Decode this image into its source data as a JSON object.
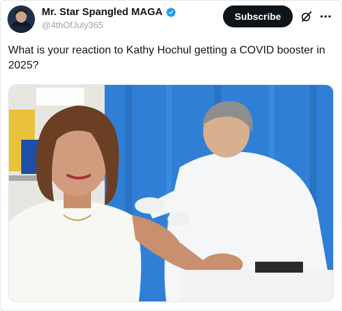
{
  "post": {
    "author": {
      "display_name": "Mr. Star Spangled MAGA",
      "handle": "@4thOfJuly365",
      "verified": true,
      "verified_color": "#1d9bf0"
    },
    "subscribe_label": "Subscribe",
    "text": "What is your reaction to Kathy Hochul getting a COVID booster in 2025?",
    "icons": {
      "avatar": "avatar-icon",
      "verified": "verified-badge-icon",
      "grok": "grok-icon",
      "more": "more-options-icon"
    },
    "colors": {
      "text": "#0f1419",
      "handle": "#9aa3ad",
      "button_bg": "#0f1419",
      "button_text": "#ffffff",
      "photo_curtain": "#2f7fd6"
    }
  }
}
